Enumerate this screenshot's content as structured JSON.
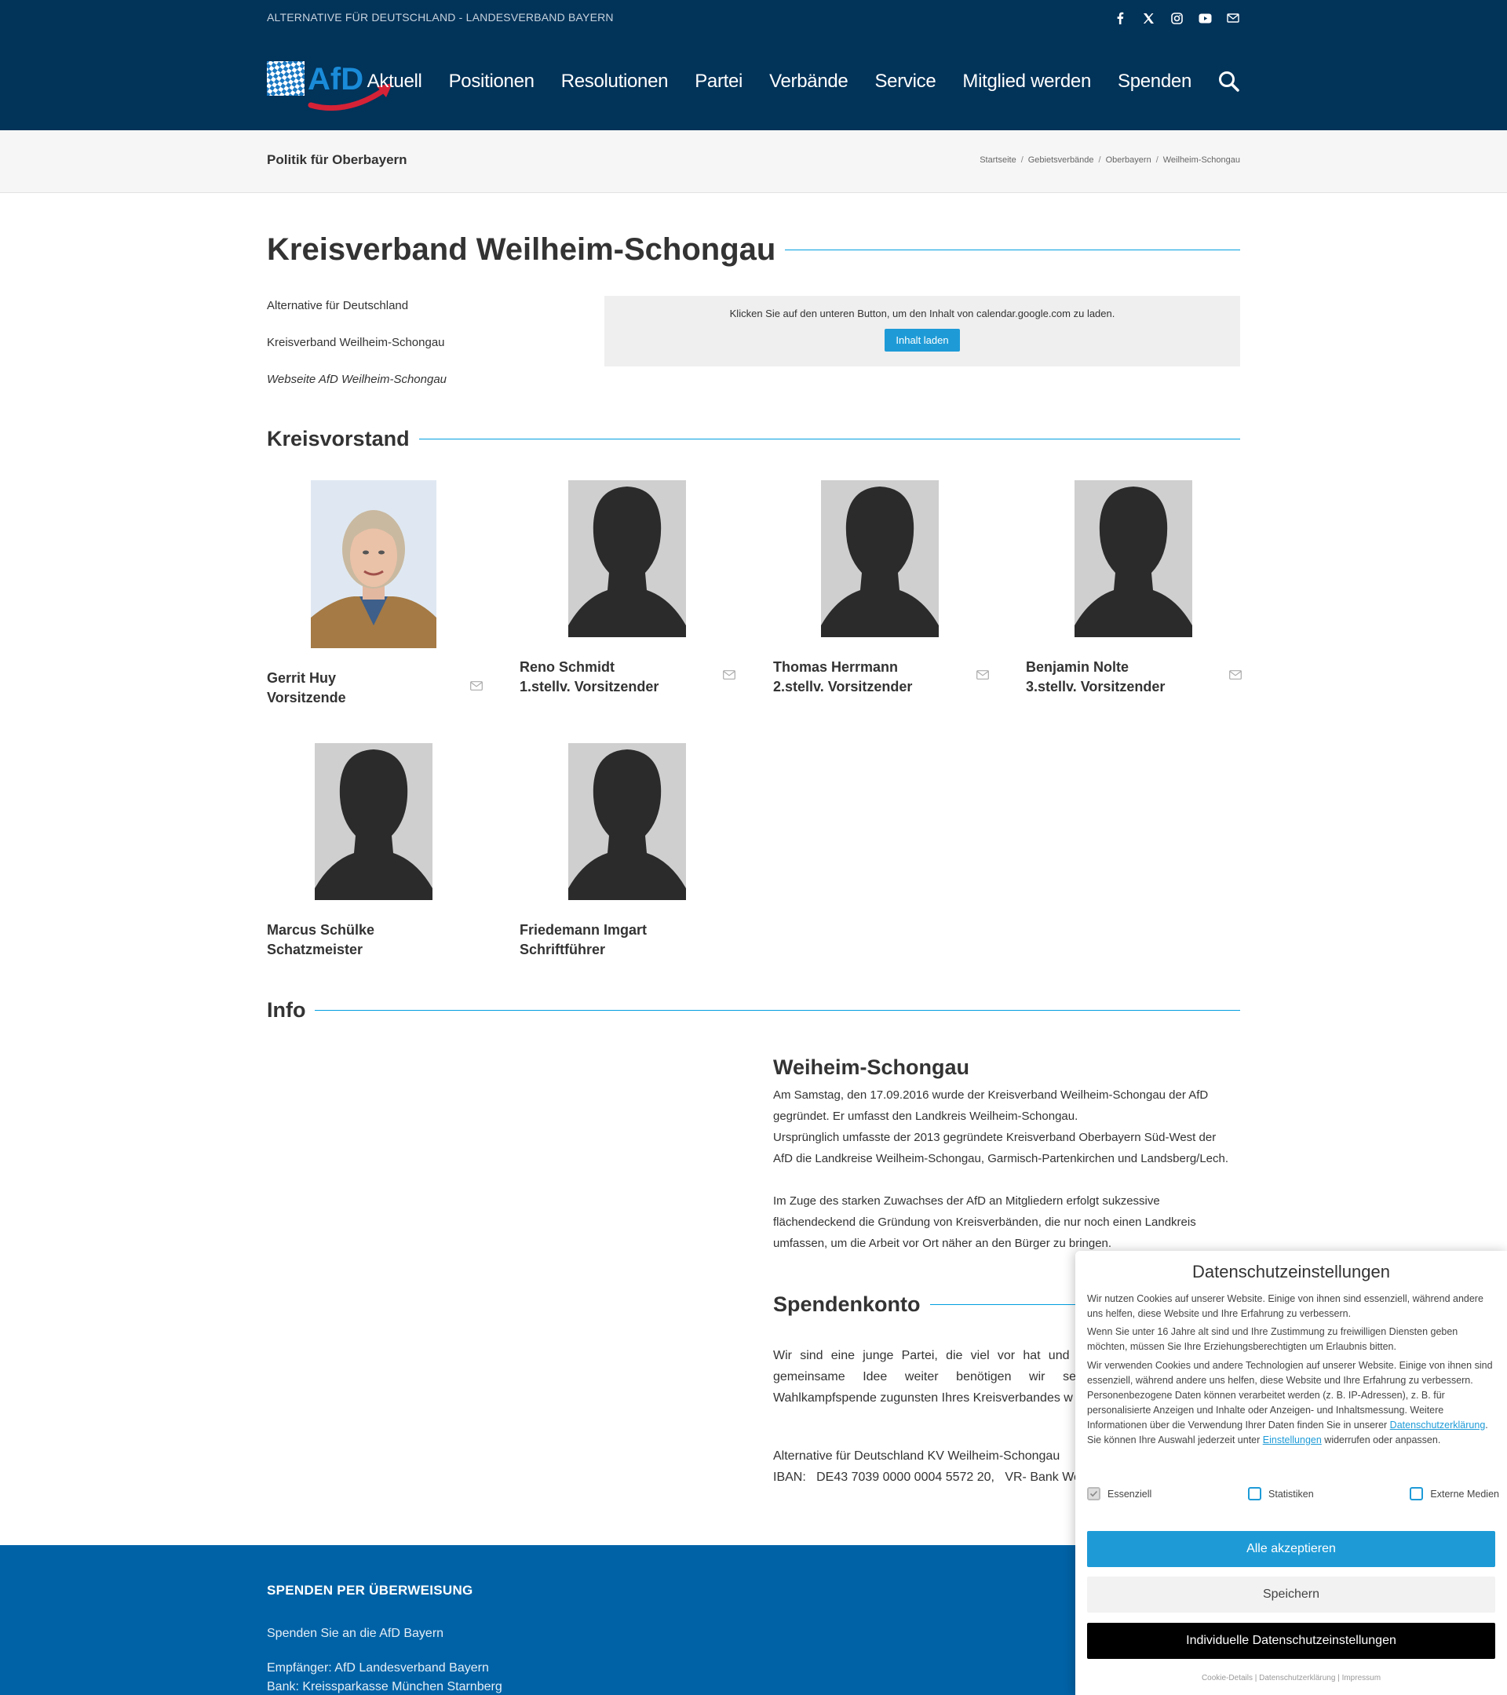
{
  "header": {
    "topbar_text": "ALTERNATIVE FÜR DEUTSCHLAND - LANDESVERBAND BAYERN",
    "social_icons": [
      "facebook-icon",
      "x-icon",
      "instagram-icon",
      "youtube-icon",
      "mail-icon"
    ],
    "logo_text": "AfD",
    "nav": [
      "Aktuell",
      "Positionen",
      "Resolutionen",
      "Partei",
      "Verbände",
      "Service",
      "Mitglied werden",
      "Spenden"
    ],
    "colors": {
      "bar": "#023359",
      "accent": "#009ee0",
      "logo_arrow": "#d62236"
    }
  },
  "titlebar": {
    "title": "Politik für Oberbayern",
    "breadcrumbs": [
      "Startseite",
      "Gebietsverbände",
      "Oberbayern",
      "Weilheim-Schongau"
    ],
    "separator": "/"
  },
  "main": {
    "heading": "Kreisverband Weilheim-Schongau",
    "intro": [
      "Alternative für Deutschland",
      "Kreisverband Weilheim-Schongau",
      "Webseite AfD Weilheim-Schongau"
    ],
    "calendar": {
      "message": "Klicken Sie auf den unteren Button, um den Inhalt von calendar.google.com zu laden.",
      "button": "Inhalt laden"
    },
    "board_heading": "Kreisvorstand",
    "members": [
      {
        "name": "Gerrit Huy",
        "role": "Vorsitzende"
      },
      {
        "name": "Reno Schmidt",
        "role": "1.stellv. Vorsitzender"
      },
      {
        "name": "Thomas Herrmann",
        "role": "2.stellv. Vorsitzender"
      },
      {
        "name": "Benjamin Nolte",
        "role": "3.stellv. Vorsitzender"
      },
      {
        "name": "Marcus Schülke",
        "role": "Schatzmeister"
      },
      {
        "name": "Friedemann Imgart",
        "role": "Schriftführer"
      }
    ],
    "info_heading": "Info",
    "info": {
      "title": "Weiheim-Schongau",
      "paragraphs": [
        "Am Samstag, den 17.09.2016 wurde der Kreisverband Weilheim-Schongau der AfD gegründet. Er umfasst den Landkreis Weilheim-Schongau.",
        "Ursprünglich umfasste der 2013 gegründete Kreisverband Oberbayern Süd-West der AfD die Landkreise Weilheim-Schongau, Garmisch-Partenkirchen und Landsberg/Lech.",
        "Im Zuge des starken Zuwachses der AfD an Mitgliedern erfolgt sukzessive flächendeckend die Gründung von Kreisverbänden, die nur noch einen Landkreis umfassen, um die Arbeit vor Ort näher an den Bürger zu bringen."
      ]
    },
    "spendenkonto": {
      "heading": "Spendenkonto",
      "text": "Wir sind eine junge Partei, die viel vor hat und ausgesetzt ist. Um unsere gemeinsame Idee weiter benötigen wir selbstverständlich finanzielle Wahlkampfspende zugunsten Ihres Kreisverbandes w",
      "account_line1": "Alternative für Deutschland KV Weilheim-Schongau",
      "account_line2": "IBAN:   DE43 7039 0000 0004 5572 20,   VR- Bank Wer"
    }
  },
  "footer": {
    "heading": "SPENDEN PER ÜBERWEISUNG",
    "lines": [
      "Spenden Sie an die AfD Bayern",
      "Empfänger: AfD Landesverband Bayern",
      "Bank: Kreissparkasse München Starnberg"
    ]
  },
  "cookie": {
    "title": "Datenschutzeinstellungen",
    "p1": "Wir nutzen Cookies auf unserer Website. Einige von ihnen sind essenziell, während andere uns helfen, diese Website und Ihre Erfahrung zu verbessern.",
    "p2": "Wenn Sie unter 16 Jahre alt sind und Ihre Zustimmung zu freiwilligen Diensten geben möchten, müssen Sie Ihre Erziehungsberechtigten um Erlaubnis bitten.",
    "p3_a": "Wir verwenden Cookies und andere Technologien auf unserer Website. Einige von ihnen sind essenziell, während andere uns helfen, diese Website und Ihre Erfahrung zu verbessern. Personenbezogene Daten können verarbeitet werden (z. B. IP-Adressen), z. B. für personalisierte Anzeigen und Inhalte oder Anzeigen- und Inhaltsmessung. Weitere Informationen über die Verwendung Ihrer Daten finden Sie in unserer ",
    "p3_link1": "Datenschutzerklärung",
    "p3_b": ". Sie können Ihre Auswahl jederzeit unter ",
    "p3_link2": "Einstellungen",
    "p3_c": " widerrufen oder anpassen.",
    "options": [
      "Essenziell",
      "Statistiken",
      "Externe Medien"
    ],
    "accept": "Alle akzeptieren",
    "save": "Speichern",
    "individual": "Individuelle Datenschutzeinstellungen",
    "links": [
      "Cookie-Details",
      "Datenschutzerklärung",
      "Impressum"
    ]
  }
}
